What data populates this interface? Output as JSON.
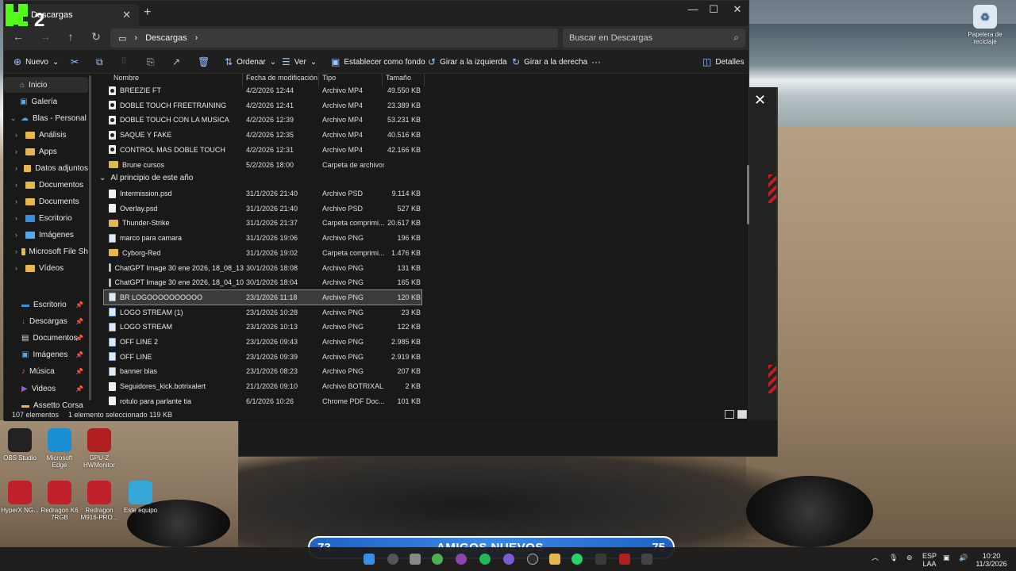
{
  "window": {
    "tab_title": "Descargas",
    "logo_text": "2",
    "address": {
      "segment": "Descargas"
    },
    "search_placeholder": "Buscar en Descargas",
    "toolbar": {
      "new": "Nuevo",
      "sort": "Ordenar",
      "view": "Ver",
      "set_bg": "Establecer como fondo",
      "rot_left": "Girar a la izquierda",
      "rot_right": "Girar a la derecha",
      "more": "···",
      "details": "Detalles"
    },
    "sidebar": {
      "top": [
        {
          "label": "Inicio",
          "icon": "home-icon"
        },
        {
          "label": "Galería",
          "icon": "gallery-icon"
        },
        {
          "label": "Blas - Personal",
          "icon": "cloud-icon"
        },
        {
          "label": "Análisis"
        },
        {
          "label": "Apps"
        },
        {
          "label": "Datos adjuntos"
        },
        {
          "label": "Documentos"
        },
        {
          "label": "Documents"
        },
        {
          "label": "Escritorio"
        },
        {
          "label": "Imágenes"
        },
        {
          "label": "Microsoft File Sh"
        },
        {
          "label": "Vídeos"
        }
      ],
      "quick": [
        {
          "label": "Escritorio"
        },
        {
          "label": "Descargas"
        },
        {
          "label": "Documentos"
        },
        {
          "label": "Imágenes"
        },
        {
          "label": "Música"
        },
        {
          "label": "Videos"
        },
        {
          "label": "Assetto Corsa"
        }
      ]
    },
    "columns": {
      "name": "Nombre",
      "date": "Fecha de modificación",
      "type": "Tipo",
      "size": "Tamaño"
    },
    "group_header": "Al principio de este año",
    "rows_top": [
      {
        "name": "BREEZIE FT",
        "date": "4/2/2026 12:44",
        "type": "Archivo MP4",
        "size": "49.550 KB",
        "kind": "vid"
      },
      {
        "name": "DOBLE TOUCH FREETRAINING",
        "date": "4/2/2026 12:41",
        "type": "Archivo MP4",
        "size": "23.389 KB",
        "kind": "vid"
      },
      {
        "name": "DOBLE TOUCH CON LA MUSICA",
        "date": "4/2/2026 12:39",
        "type": "Archivo MP4",
        "size": "53.231 KB",
        "kind": "vid"
      },
      {
        "name": "SAQUE Y FAKE",
        "date": "4/2/2026 12:35",
        "type": "Archivo MP4",
        "size": "40.516 KB",
        "kind": "vid"
      },
      {
        "name": "CONTROL MAS DOBLE TOUCH",
        "date": "4/2/2026 12:31",
        "type": "Archivo MP4",
        "size": "42.166 KB",
        "kind": "vid"
      },
      {
        "name": "Brune cursos",
        "date": "5/2/2026 18:00",
        "type": "Carpeta de archivos",
        "size": "",
        "kind": "fold2"
      }
    ],
    "rows_group": [
      {
        "name": "Intermission.psd",
        "date": "31/1/2026 21:40",
        "type": "Archivo PSD",
        "size": "9.114 KB",
        "kind": "doc"
      },
      {
        "name": "Overlay.psd",
        "date": "31/1/2026 21:40",
        "type": "Archivo PSD",
        "size": "527 KB",
        "kind": "doc"
      },
      {
        "name": "Thunder-Strike",
        "date": "31/1/2026 21:37",
        "type": "Carpeta comprimi...",
        "size": "20.617 KB",
        "kind": "fold2"
      },
      {
        "name": "marco para camara",
        "date": "31/1/2026 19:06",
        "type": "Archivo PNG",
        "size": "196 KB",
        "kind": "img"
      },
      {
        "name": "Cyborg-Red",
        "date": "31/1/2026 19:02",
        "type": "Carpeta comprimi...",
        "size": "1.476 KB",
        "kind": "fold2"
      },
      {
        "name": "ChatGPT Image 30 ene 2026, 18_08_13",
        "date": "30/1/2026 18:08",
        "type": "Archivo PNG",
        "size": "131 KB",
        "kind": "img"
      },
      {
        "name": "ChatGPT Image 30 ene 2026, 18_04_10",
        "date": "30/1/2026 18:04",
        "type": "Archivo PNG",
        "size": "165 KB",
        "kind": "img"
      },
      {
        "name": "BR LOGOOOOOOOOOO",
        "date": "23/1/2026 11:18",
        "type": "Archivo PNG",
        "size": "120 KB",
        "kind": "img",
        "selected": true
      },
      {
        "name": "LOGO STREAM (1)",
        "date": "23/1/2026 10:28",
        "type": "Archivo PNG",
        "size": "23 KB",
        "kind": "img"
      },
      {
        "name": "LOGO STREAM",
        "date": "23/1/2026 10:13",
        "type": "Archivo PNG",
        "size": "122 KB",
        "kind": "img"
      },
      {
        "name": "OFF LINE 2",
        "date": "23/1/2026 09:43",
        "type": "Archivo PNG",
        "size": "2.985 KB",
        "kind": "img"
      },
      {
        "name": "OFF LINE",
        "date": "23/1/2026 09:39",
        "type": "Archivo PNG",
        "size": "2.919 KB",
        "kind": "img"
      },
      {
        "name": "banner blas",
        "date": "23/1/2026 08:23",
        "type": "Archivo PNG",
        "size": "207 KB",
        "kind": "img"
      },
      {
        "name": "Seguidores_kick.botrixalert",
        "date": "21/1/2026 09:10",
        "type": "Archivo BOTRIXAL...",
        "size": "2 KB",
        "kind": "doc"
      },
      {
        "name": "rotulo para parlante tia",
        "date": "6/1/2026 10:26",
        "type": "Chrome PDF Doc...",
        "size": "101 KB",
        "kind": "doc"
      }
    ],
    "status": {
      "count": "107 elementos",
      "selected": "1 elemento seleccionado  119 KB"
    }
  },
  "desktop": {
    "recycle": "Papelera de reciclaje",
    "icons": [
      {
        "label": "OBS Studio",
        "color": "#222"
      },
      {
        "label": "Microsoft Edge",
        "color": "#1a8fd6"
      },
      {
        "label": "GPU-Z HWMonitor",
        "color": "#b01e1e"
      },
      {
        "label": "HyperX NG...",
        "color": "#c0202a"
      },
      {
        "label": "Redragon K6 7RGB",
        "color": "#c0202a"
      },
      {
        "label": "Redragon M916-PRO...",
        "color": "#c0202a"
      },
      {
        "label": "Este equipo",
        "color": "#35a8d8"
      }
    ]
  },
  "overlay": {
    "left_count": "73",
    "title": "AMIGOS NUEVOS",
    "right_count": "75"
  },
  "taskbar": {
    "lang": "ESP",
    "lang2": "LAA",
    "time": "10:20",
    "date": "11/3/2026"
  }
}
